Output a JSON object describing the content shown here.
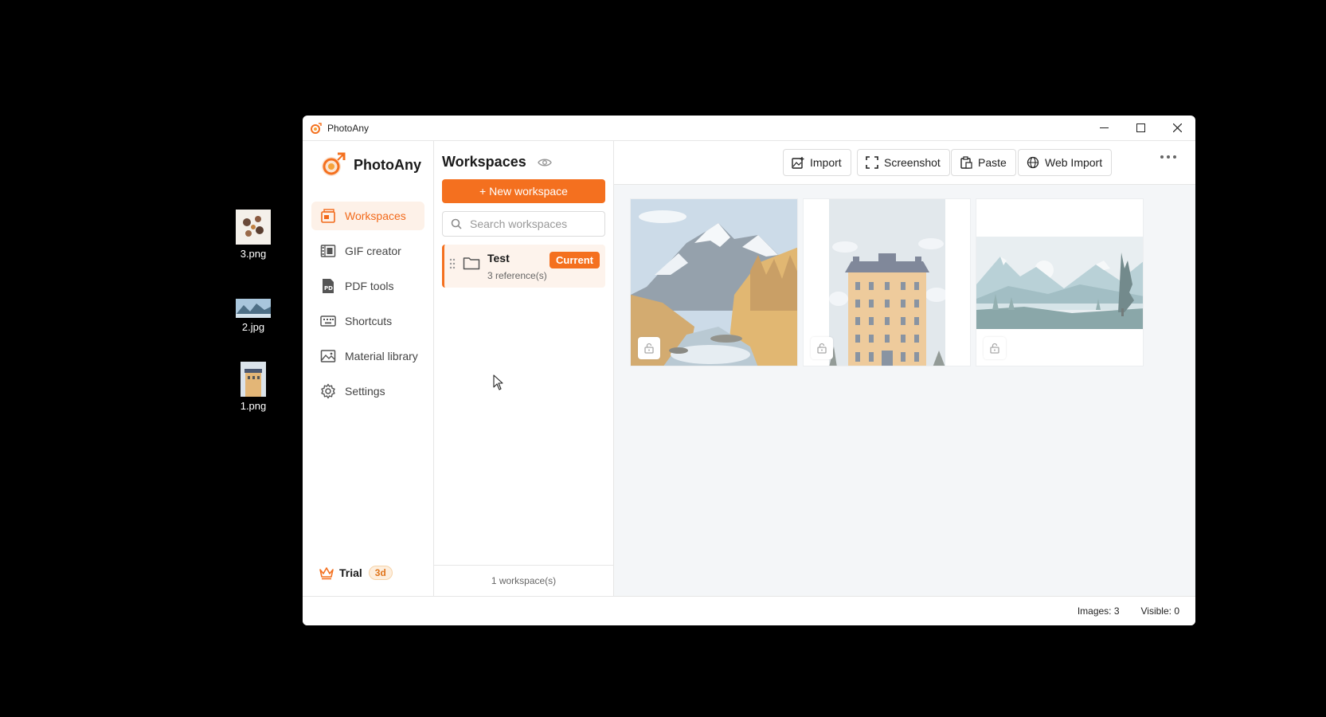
{
  "desktop": {
    "icons": [
      {
        "label": "3.png"
      },
      {
        "label": "2.jpg"
      },
      {
        "label": "1.png"
      }
    ]
  },
  "window": {
    "title": "PhotoAny"
  },
  "sidebar": {
    "brand": "PhotoAny",
    "items": [
      {
        "label": "Workspaces",
        "icon": "workspaces-icon",
        "active": true
      },
      {
        "label": "GIF creator",
        "icon": "gif-icon"
      },
      {
        "label": "PDF tools",
        "icon": "pdf-icon"
      },
      {
        "label": "Shortcuts",
        "icon": "keyboard-icon"
      },
      {
        "label": "Material library",
        "icon": "image-library-icon"
      },
      {
        "label": "Settings",
        "icon": "gear-icon"
      }
    ],
    "trial": {
      "label": "Trial",
      "badge": "3d"
    }
  },
  "workspaces_panel": {
    "title": "Workspaces",
    "new_button": "+ New workspace",
    "search_placeholder": "Search workspaces",
    "items": [
      {
        "name": "Test",
        "refs": "3 reference(s)",
        "badge": "Current"
      }
    ],
    "footer": "1 workspace(s)"
  },
  "toolbar": {
    "import": "Import",
    "screenshot": "Screenshot",
    "paste": "Paste",
    "web_import": "Web Import"
  },
  "images": [
    {
      "name": "mountain-river",
      "locked": false
    },
    {
      "name": "building",
      "locked": false
    },
    {
      "name": "lake-landscape",
      "locked": false
    }
  ],
  "status": {
    "images": "Images: 3",
    "visible": "Visible: 0"
  },
  "colors": {
    "accent": "#f4701f",
    "accent_light": "#fdf1e8"
  }
}
